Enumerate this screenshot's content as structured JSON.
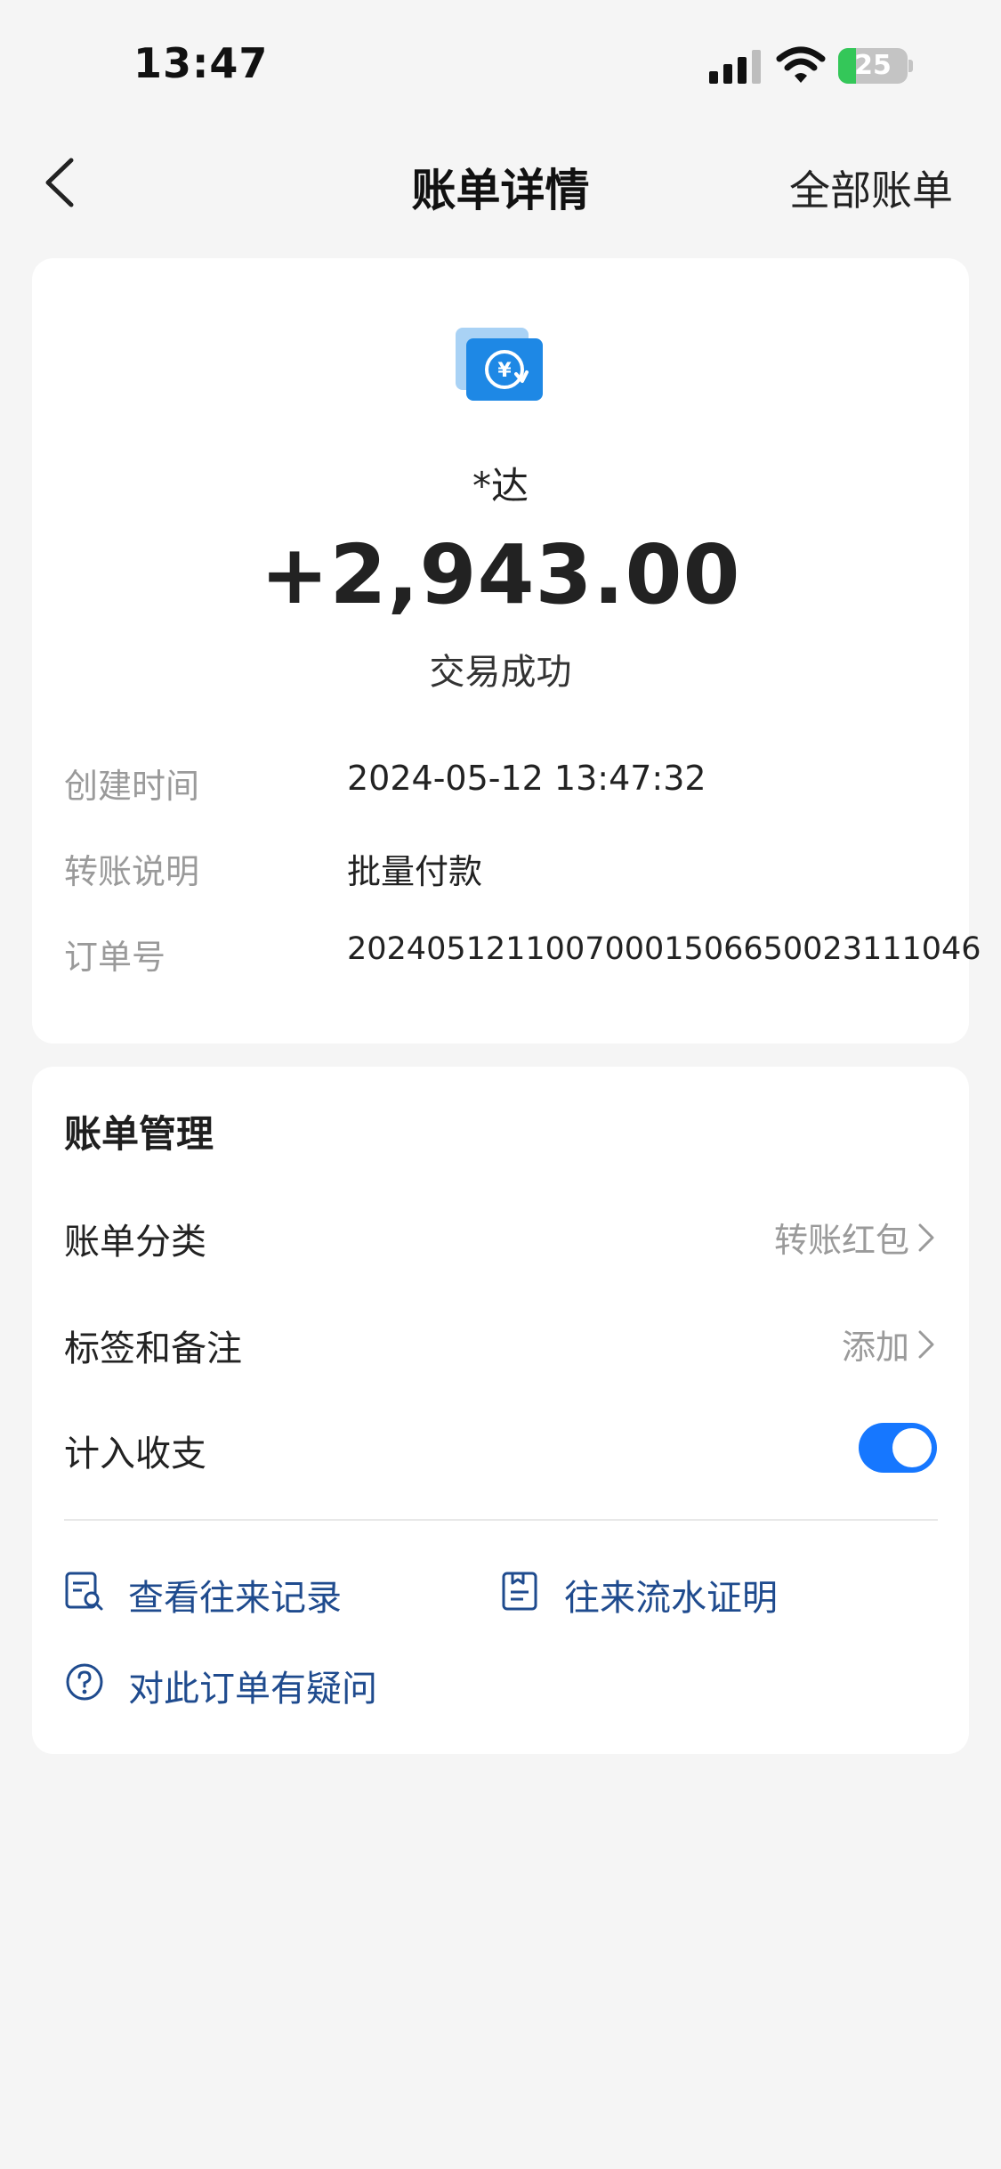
{
  "status_bar": {
    "time": "13:47",
    "battery_level": "25",
    "battery_fraction": 0.25
  },
  "nav": {
    "title": "账单详情",
    "right_action": "全部账单"
  },
  "transaction": {
    "payer": "*达",
    "amount": "+2,943.00",
    "status": "交易成功",
    "details": [
      {
        "label": "创建时间",
        "value": "2024-05-12 13:47:32"
      },
      {
        "label": "转账说明",
        "value": "批量付款"
      },
      {
        "label": "订单号",
        "value": "20240512110070001506650023111046"
      }
    ]
  },
  "management": {
    "title": "账单管理",
    "category": {
      "label": "账单分类",
      "value": "转账红包"
    },
    "tags": {
      "label": "标签和备注",
      "value": "添加"
    },
    "include": {
      "label": "计入收支",
      "enabled": true
    },
    "links": {
      "history": "查看往来记录",
      "proof": "往来流水证明",
      "question": "对此订单有疑问"
    }
  },
  "colors": {
    "accent": "#1677ff",
    "link": "#1f4b8e",
    "background": "#f5f5f5",
    "battery": "#34c759"
  }
}
